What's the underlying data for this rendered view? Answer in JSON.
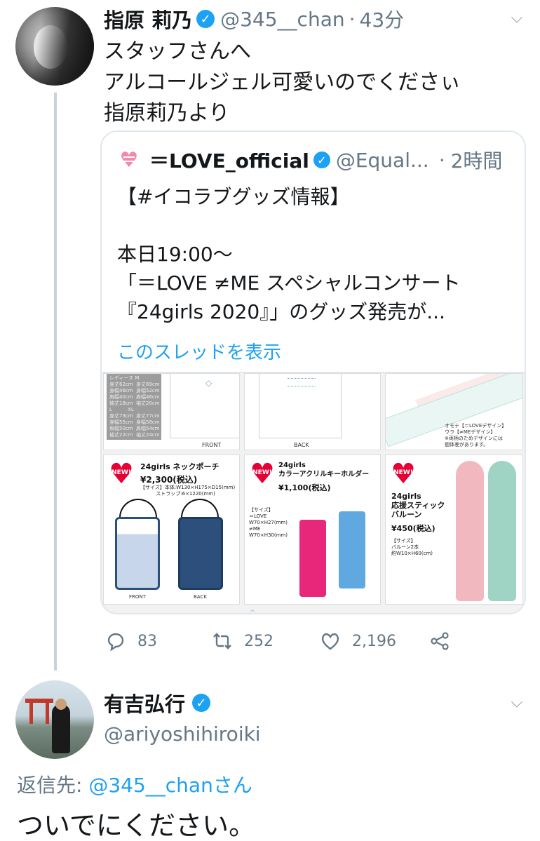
{
  "tweet": {
    "author_name": "指原 莉乃",
    "handle": "@345__chan",
    "separator": "·",
    "time": "43分",
    "text_lines": [
      "スタッフさんへ",
      "アルコールジェル可愛いのでくださぃ",
      "指原莉乃より"
    ],
    "quote": {
      "name": "＝LOVE_official",
      "handle": "@Equal...",
      "separator": "·",
      "time": "2時間",
      "body_lines": [
        "【#イコラブグッズ情報】",
        "",
        "本日19:00〜",
        "「＝LOVE ≠ME スペシャルコンサート",
        "『24girls 2020』」のグッズ発売が..."
      ],
      "show_thread": "このスレッドを表示",
      "media": {
        "front_label": "FRONT",
        "back_label": "BACK",
        "new_badge": "NEW!",
        "size_chart": "レディース M\n身丈62cm  身丈69cm\n身幅46cm  身幅52cm\n肩幅40cm  肩幅46cm\n袖丈18cm  袖丈20cm\nL          XL\n身丈73cm  身丈77cm\n身幅55cm  身幅58cm\n肩幅50cm  肩幅54cm\n袖丈22cm  袖丈24cm",
        "towel_note": "オモテ【＝LOVEデザイン】\nウラ【≠MEデザイン】\n※両柄のためデザインには\n個体差があります。",
        "pouch_title": "24girls ネックポーチ",
        "pouch_price": "¥2,300(税込)",
        "pouch_info": "【サイズ】本体:W130×H175×D15(mm)\n          ストラップ:6×1220(mm)",
        "key_title": "24girls\nカラーアクリルキーホルダー",
        "key_price": "¥1,100(税込)",
        "key_info": "【サイズ】\n＝LOVE\nW70×H27(mm)\n≠ME\nW70×H30(mm)",
        "stick_title": "24girls\n応援スティック\nバルーン",
        "stick_price": "¥450(税込)",
        "stick_info": "【サイズ】\nバルーン2本\n約W10×H60(cm)"
      }
    },
    "actions": {
      "replies": "83",
      "retweets": "252",
      "likes": "2,196"
    }
  },
  "reply": {
    "author_name": "有吉弘行",
    "handle": "@ariyoshihiroiki",
    "reply_prefix": "返信先:",
    "reply_target": "@345__chanさん",
    "text": "ついでにください。"
  },
  "icons": [
    "verified-badge-icon",
    "chevron-down-icon",
    "reply-icon",
    "retweet-icon",
    "like-icon",
    "share-icon"
  ],
  "colors": {
    "accent": "#1da1f2",
    "secondary_text": "#657786",
    "border": "#e1e8ed"
  }
}
